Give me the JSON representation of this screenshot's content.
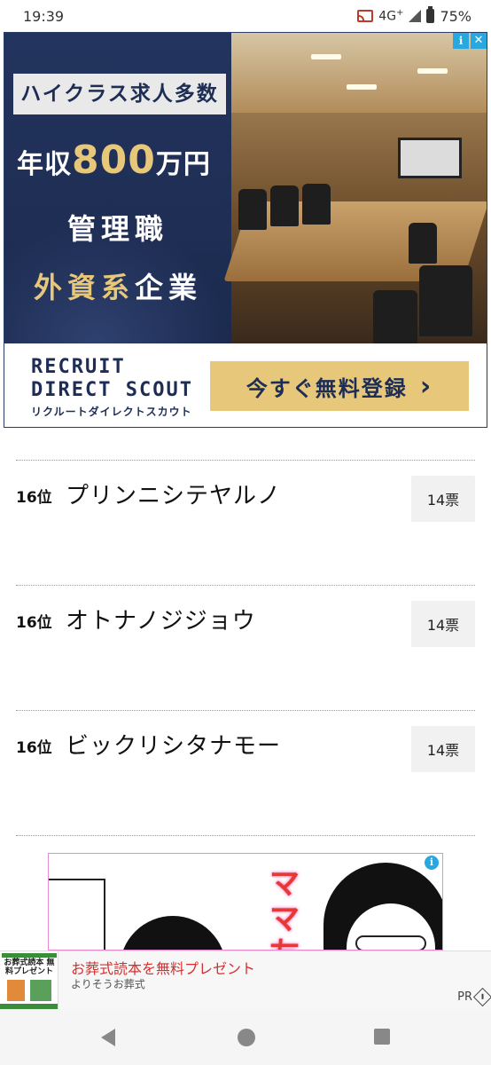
{
  "status_bar": {
    "time": "19:39",
    "network": "4G",
    "network_sup": "+",
    "battery": "75%"
  },
  "top_ad": {
    "tag": "ハイクラス求人多数",
    "salary_prefix": "年収",
    "salary_number": "800",
    "salary_suffix": "万円",
    "line1": "管理職",
    "line2_a": "外資系",
    "line2_b": "企業",
    "brand_line1": "RECRUIT",
    "brand_line2": "DIRECT SCOUT",
    "brand_kana": "リクルートダイレクトスカウト",
    "cta_label": "今すぐ無料登録",
    "cta_arrow": "›",
    "info_icon": "i",
    "close_icon": "✕"
  },
  "ranking": [
    {
      "position": "16位",
      "name": "プリンニシテヤルノ",
      "votes": "14票"
    },
    {
      "position": "16位",
      "name": "オトナノジジョウ",
      "votes": "14票"
    },
    {
      "position": "16位",
      "name": "ビックリシタナモー",
      "votes": "14票"
    }
  ],
  "lower_ad": {
    "manga_title": "ママ友",
    "info_icon": "i"
  },
  "banner_ad": {
    "thumb_title": "お葬式読本 無料プレゼント",
    "title": "お葬式読本を無料プレゼント",
    "sponsor": "よりそうお葬式",
    "pr": "PR"
  },
  "colors": {
    "navy": "#1d2d55",
    "gold": "#e7c77a",
    "banner_red": "#d32f2f",
    "info_blue": "#29a8e0"
  }
}
